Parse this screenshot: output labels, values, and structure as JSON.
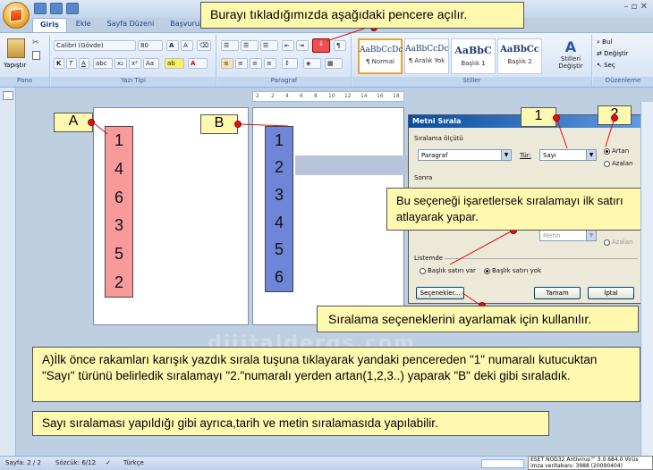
{
  "window": {
    "tabs": [
      "Giriş",
      "Ekle",
      "Sayfa Düzeni",
      "Başvurular"
    ],
    "controls": "– ▫ ✕"
  },
  "ribbon": {
    "pano": {
      "paste": "Yapıştır",
      "label": "Pano"
    },
    "font": {
      "name": "Calibri (Gövde)",
      "size": "80",
      "label": "Yazı Tipi",
      "bold": "K",
      "italic": "T",
      "underline": "A"
    },
    "paragraph": {
      "label": "Paragraf"
    },
    "styles": {
      "items": [
        {
          "preview": "AaBbCcDc",
          "name": "¶ Normal"
        },
        {
          "preview": "AaBbCcDc",
          "name": "¶ Aralık Yok"
        },
        {
          "preview": "AaBbC",
          "name": "Başlık 1"
        },
        {
          "preview": "AaBbCc",
          "name": "Başlık 2"
        }
      ],
      "change": "Stilleri Değiştir",
      "label": "Stiller"
    },
    "editing": {
      "find": "Bul",
      "replace": "Değiştir",
      "select": "Seç",
      "label": "Düzenleme"
    }
  },
  "ruler": {
    "ticks": [
      "2",
      "2",
      "4",
      "6",
      "8",
      "10",
      "12",
      "14",
      "16",
      "18"
    ]
  },
  "document": {
    "col_a": [
      "1",
      "4",
      "6",
      "3",
      "5",
      "2"
    ],
    "col_b": [
      "1",
      "2",
      "3",
      "4",
      "5",
      "6"
    ],
    "label_a": "A",
    "label_b": "B",
    "watermark": "dijitaldergs.com"
  },
  "dialog": {
    "title": "Metni Sırala",
    "sort_by": "Sıralama ölçütü",
    "field1": "Paragraf",
    "type_label": "Tür:",
    "type1": "Sayı",
    "asc": "Artan",
    "desc": "Azalan",
    "then": "Sonra",
    "type2": "Metin",
    "desc2": "Azalan",
    "list": "Listemde",
    "has_header": "Başlık satırı var",
    "no_header": "Başlık satırı yok",
    "options": "Seçenekler...",
    "ok": "Tamam",
    "cancel": "İptal"
  },
  "callouts": {
    "top": "Burayı tıkladığımızda aşağıdaki pencere açılır.",
    "n1": "1",
    "n2": "2",
    "header_row": "Bu seçeneği işaretlersek sıralamayı ilk satırı atlayarak yapar.",
    "options": "Sıralama seçeneklerini ayarlamak için kullanılır.",
    "explain": "A)İlk önce rakamları karışık yazdık sırala tuşuna tıklayarak yandaki pencereden \"1\" numaralı kutucuktan \"Sayı\" türünü belirledik sıralamayı \"2.\"numaralı yerden artan(1,2,3..) yaparak \"B\" deki gibi sıraladık.",
    "note": "Sayı sıralaması yapıldığı gibi ayrıca,tarih ve metin sıralamasıda yapılabilir."
  },
  "status": {
    "page": "Sayfa: 2 / 2",
    "words": "Sözcük: 6/12",
    "lang": "Türkçe",
    "eset": "ESET NOD32 Antivirus™ 3.0.684.0 Virüs imza veritabanı: 3988 (20090404)"
  },
  "colors": {
    "red_col": "#f89a9a",
    "blue_col": "#6f86d8",
    "callout": "#fff9b0",
    "dot": "#e01010"
  }
}
